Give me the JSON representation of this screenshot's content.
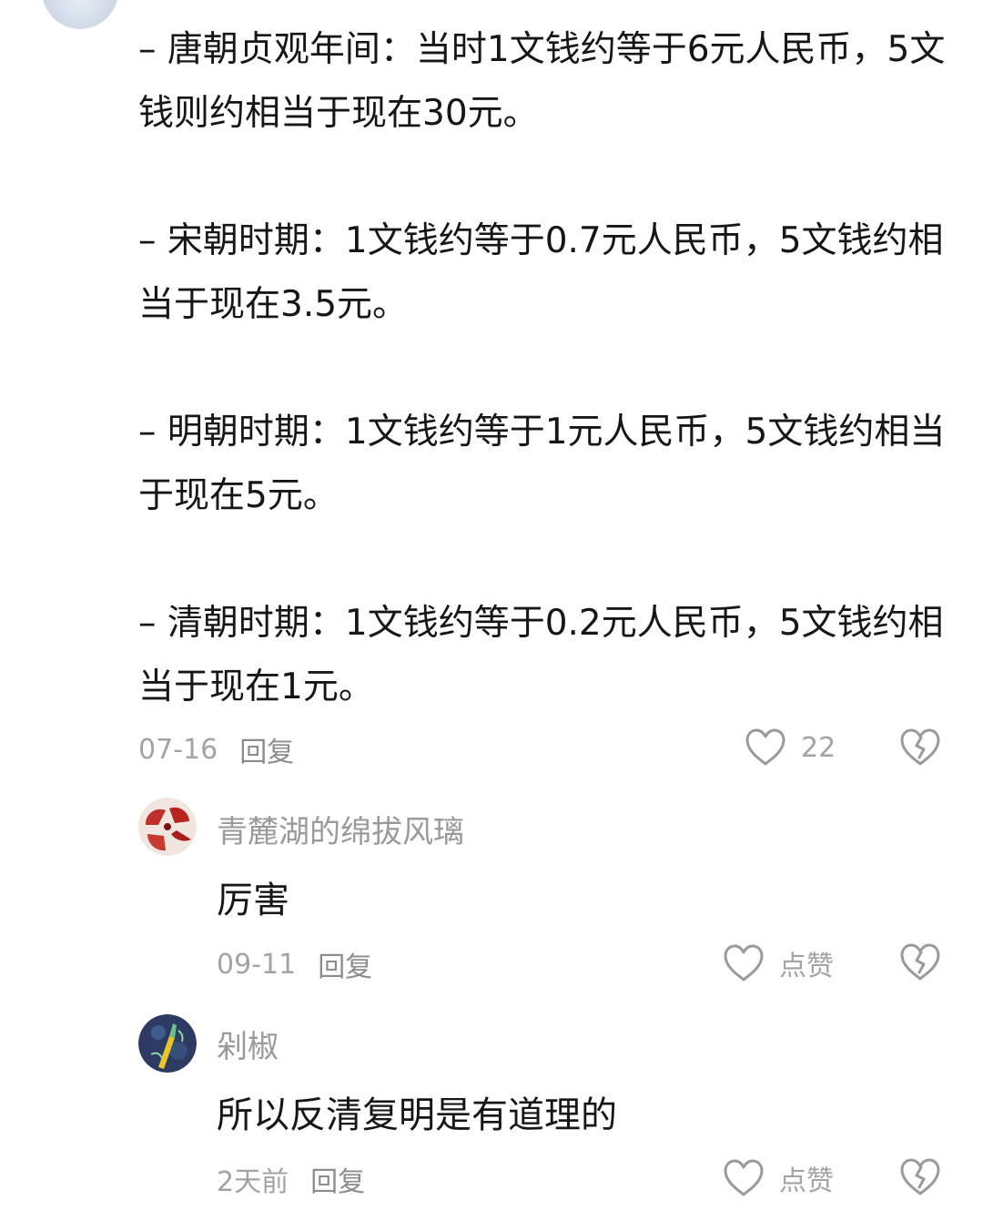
{
  "comment": {
    "paragraphs": [
      "– 唐朝贞观年间：当时1文钱约等于6元人民币，5文钱则约相当于现在30元。",
      "– 宋朝时期：1文钱约等于0.7元人民币，5文钱约相当于现在3.5元。",
      "– 明朝时期：1文钱约等于1元人民币，5文钱约相当于现在5元。",
      "– 清朝时期：1文钱约等于0.2元人民币，5文钱约相当于现在1元。"
    ],
    "date": "07-16",
    "reply_label": "回复",
    "like_count": "22"
  },
  "replies": [
    {
      "username": "青麓湖的绵拔风璃",
      "text": "厉害",
      "date": "09-11",
      "reply_label": "回复",
      "like_label": "点赞"
    },
    {
      "username": "剁椒",
      "text": "所以反清复明是有道理的",
      "date": "2天前",
      "reply_label": "回复",
      "like_label": "点赞"
    }
  ],
  "icons": {
    "like": "heart-outline-icon",
    "dislike": "broken-heart-icon"
  },
  "colors": {
    "text": "#161616",
    "meta": "#a3a3a3",
    "username": "#9a9a9a"
  }
}
